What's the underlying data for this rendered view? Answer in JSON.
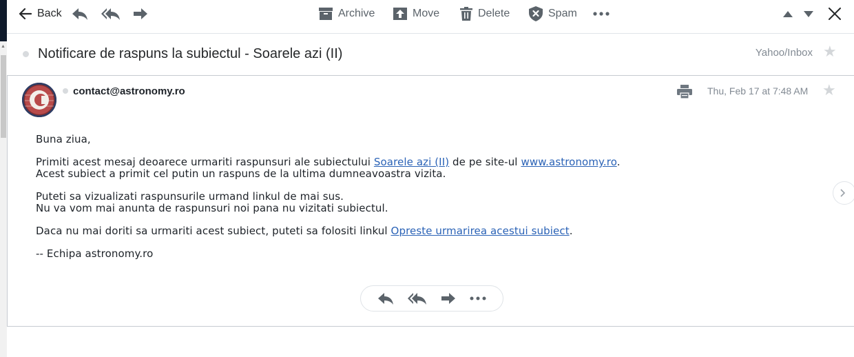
{
  "toolbar": {
    "back_label": "Back",
    "archive_label": "Archive",
    "move_label": "Move",
    "delete_label": "Delete",
    "spam_label": "Spam"
  },
  "message": {
    "subject": "Notificare de raspuns la subiectul - Soarele azi (II)",
    "folder": "Yahoo/Inbox",
    "sender": "contact@astronomy.ro",
    "date": "Thu, Feb 17 at 7:48 AM",
    "body": {
      "greeting": "Buna ziua,",
      "p1_pre": "Primiti acest mesaj deoarece urmariti raspunsuri ale subiectului ",
      "p1_link1": "Soarele azi (II)",
      "p1_mid": " de pe site-ul ",
      "p1_link2": "www.astronomy.ro",
      "p1_post": ".",
      "p1_line2": "Acest subiect a primit cel putin un raspuns de la ultima dumneavoastra vizita.",
      "p2_line1": "Puteti sa vizualizati raspunsurile urmand linkul de mai sus.",
      "p2_line2": "Nu va vom mai anunta de raspunsuri noi pana nu vizitati subiectul.",
      "p3_pre": "Daca nu mai doriti sa urmariti acest subiect, puteti sa folositi linkul ",
      "p3_link": "Opreste urmarirea acestui subiect",
      "p3_post": ".",
      "signature": "-- Echipa astronomy.ro"
    }
  },
  "colors": {
    "link": "#2a62b6",
    "icon": "#5b636a",
    "border": "#c6cad0"
  },
  "icons": [
    "back-arrow-icon",
    "reply-icon",
    "reply-all-icon",
    "forward-icon",
    "archive-icon",
    "move-icon",
    "delete-icon",
    "spam-icon",
    "more-icon",
    "previous-icon",
    "next-icon",
    "close-icon",
    "star-icon",
    "print-icon",
    "chevron-right-icon"
  ]
}
